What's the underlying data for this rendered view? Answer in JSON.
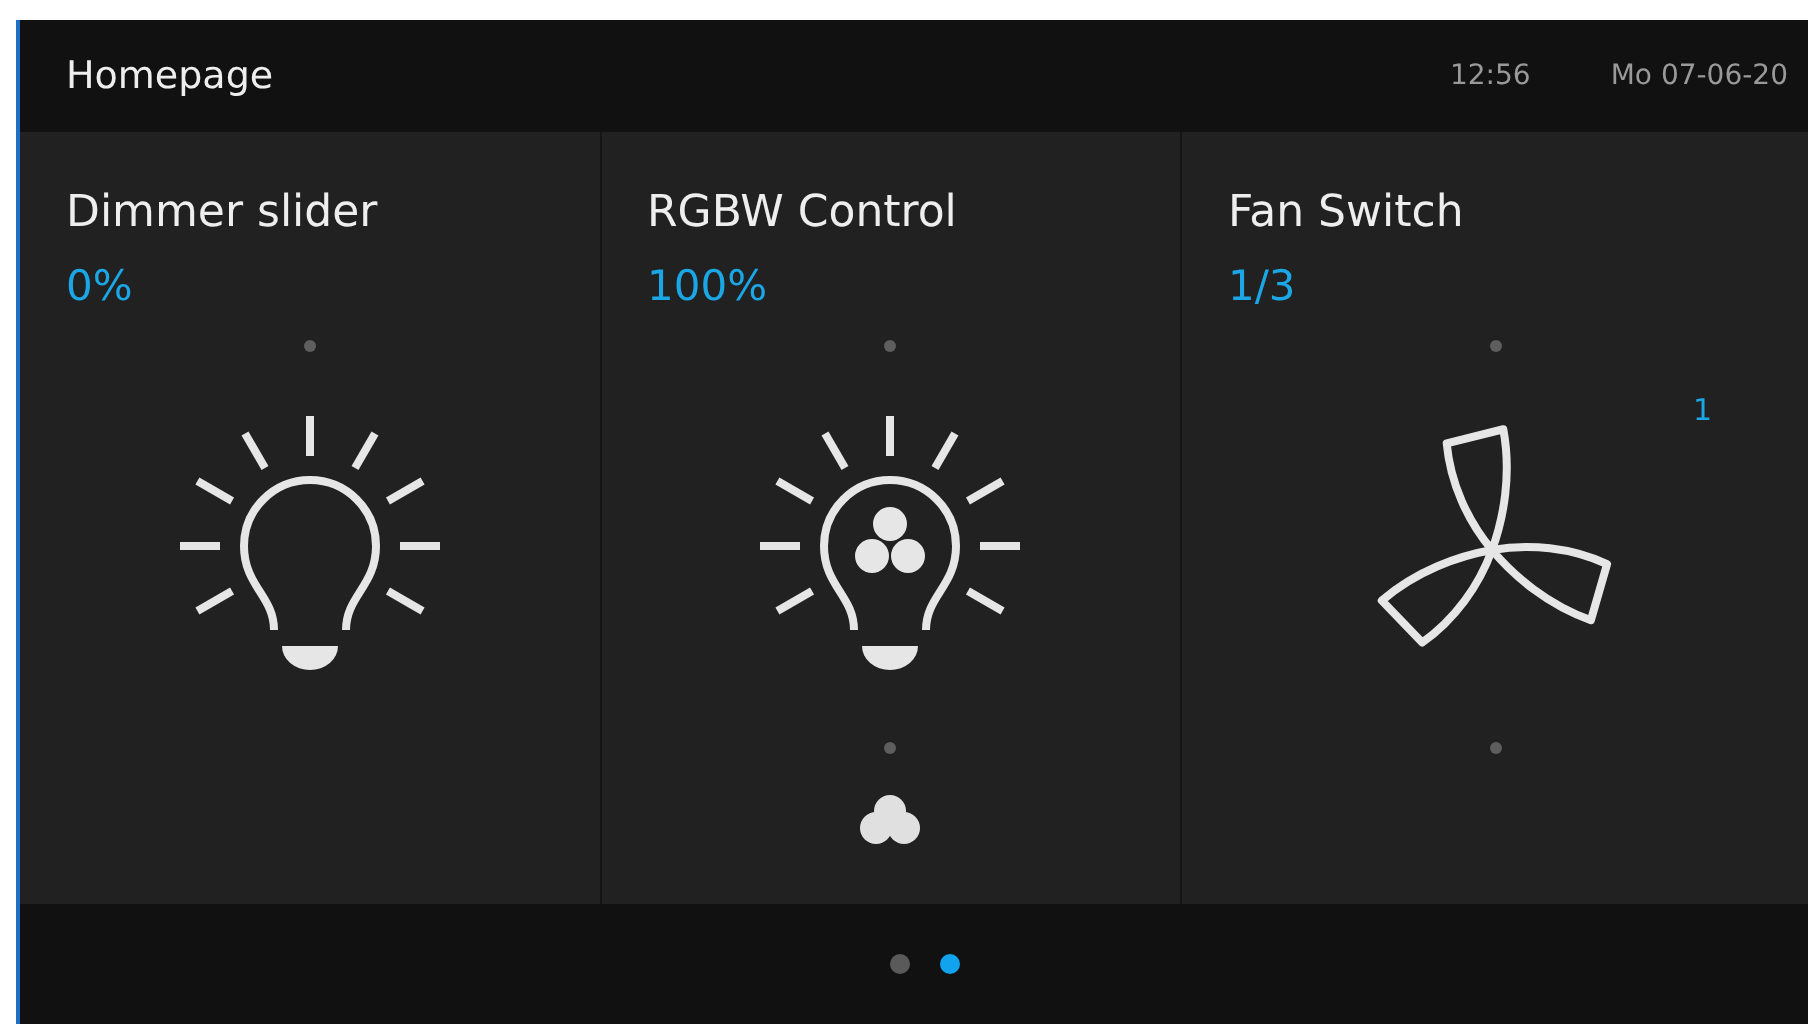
{
  "header": {
    "title": "Homepage",
    "time": "12:56",
    "date": "Mo 07-06-20"
  },
  "tiles": [
    {
      "kind": "dimmer",
      "title": "Dimmer slider",
      "value": "0%"
    },
    {
      "kind": "rgbw",
      "title": "RGBW Control",
      "value": "100%"
    },
    {
      "kind": "fan",
      "title": "Fan Switch",
      "value": "1/3",
      "badge": "1"
    }
  ],
  "pages": [
    {
      "selected": false
    },
    {
      "selected": true
    }
  ]
}
